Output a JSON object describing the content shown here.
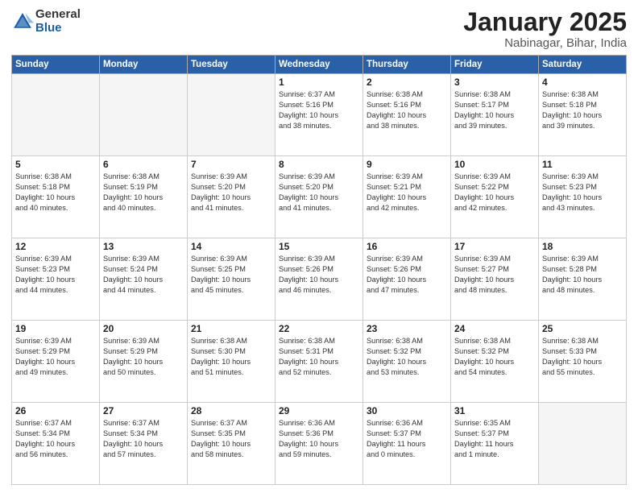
{
  "header": {
    "logo_general": "General",
    "logo_blue": "Blue",
    "title": "January 2025",
    "location": "Nabinagar, Bihar, India"
  },
  "days_of_week": [
    "Sunday",
    "Monday",
    "Tuesday",
    "Wednesday",
    "Thursday",
    "Friday",
    "Saturday"
  ],
  "weeks": [
    [
      {
        "num": "",
        "info": ""
      },
      {
        "num": "",
        "info": ""
      },
      {
        "num": "",
        "info": ""
      },
      {
        "num": "1",
        "info": "Sunrise: 6:37 AM\nSunset: 5:16 PM\nDaylight: 10 hours\nand 38 minutes."
      },
      {
        "num": "2",
        "info": "Sunrise: 6:38 AM\nSunset: 5:16 PM\nDaylight: 10 hours\nand 38 minutes."
      },
      {
        "num": "3",
        "info": "Sunrise: 6:38 AM\nSunset: 5:17 PM\nDaylight: 10 hours\nand 39 minutes."
      },
      {
        "num": "4",
        "info": "Sunrise: 6:38 AM\nSunset: 5:18 PM\nDaylight: 10 hours\nand 39 minutes."
      }
    ],
    [
      {
        "num": "5",
        "info": "Sunrise: 6:38 AM\nSunset: 5:18 PM\nDaylight: 10 hours\nand 40 minutes."
      },
      {
        "num": "6",
        "info": "Sunrise: 6:38 AM\nSunset: 5:19 PM\nDaylight: 10 hours\nand 40 minutes."
      },
      {
        "num": "7",
        "info": "Sunrise: 6:39 AM\nSunset: 5:20 PM\nDaylight: 10 hours\nand 41 minutes."
      },
      {
        "num": "8",
        "info": "Sunrise: 6:39 AM\nSunset: 5:20 PM\nDaylight: 10 hours\nand 41 minutes."
      },
      {
        "num": "9",
        "info": "Sunrise: 6:39 AM\nSunset: 5:21 PM\nDaylight: 10 hours\nand 42 minutes."
      },
      {
        "num": "10",
        "info": "Sunrise: 6:39 AM\nSunset: 5:22 PM\nDaylight: 10 hours\nand 42 minutes."
      },
      {
        "num": "11",
        "info": "Sunrise: 6:39 AM\nSunset: 5:23 PM\nDaylight: 10 hours\nand 43 minutes."
      }
    ],
    [
      {
        "num": "12",
        "info": "Sunrise: 6:39 AM\nSunset: 5:23 PM\nDaylight: 10 hours\nand 44 minutes."
      },
      {
        "num": "13",
        "info": "Sunrise: 6:39 AM\nSunset: 5:24 PM\nDaylight: 10 hours\nand 44 minutes."
      },
      {
        "num": "14",
        "info": "Sunrise: 6:39 AM\nSunset: 5:25 PM\nDaylight: 10 hours\nand 45 minutes."
      },
      {
        "num": "15",
        "info": "Sunrise: 6:39 AM\nSunset: 5:26 PM\nDaylight: 10 hours\nand 46 minutes."
      },
      {
        "num": "16",
        "info": "Sunrise: 6:39 AM\nSunset: 5:26 PM\nDaylight: 10 hours\nand 47 minutes."
      },
      {
        "num": "17",
        "info": "Sunrise: 6:39 AM\nSunset: 5:27 PM\nDaylight: 10 hours\nand 48 minutes."
      },
      {
        "num": "18",
        "info": "Sunrise: 6:39 AM\nSunset: 5:28 PM\nDaylight: 10 hours\nand 48 minutes."
      }
    ],
    [
      {
        "num": "19",
        "info": "Sunrise: 6:39 AM\nSunset: 5:29 PM\nDaylight: 10 hours\nand 49 minutes."
      },
      {
        "num": "20",
        "info": "Sunrise: 6:39 AM\nSunset: 5:29 PM\nDaylight: 10 hours\nand 50 minutes."
      },
      {
        "num": "21",
        "info": "Sunrise: 6:38 AM\nSunset: 5:30 PM\nDaylight: 10 hours\nand 51 minutes."
      },
      {
        "num": "22",
        "info": "Sunrise: 6:38 AM\nSunset: 5:31 PM\nDaylight: 10 hours\nand 52 minutes."
      },
      {
        "num": "23",
        "info": "Sunrise: 6:38 AM\nSunset: 5:32 PM\nDaylight: 10 hours\nand 53 minutes."
      },
      {
        "num": "24",
        "info": "Sunrise: 6:38 AM\nSunset: 5:32 PM\nDaylight: 10 hours\nand 54 minutes."
      },
      {
        "num": "25",
        "info": "Sunrise: 6:38 AM\nSunset: 5:33 PM\nDaylight: 10 hours\nand 55 minutes."
      }
    ],
    [
      {
        "num": "26",
        "info": "Sunrise: 6:37 AM\nSunset: 5:34 PM\nDaylight: 10 hours\nand 56 minutes."
      },
      {
        "num": "27",
        "info": "Sunrise: 6:37 AM\nSunset: 5:34 PM\nDaylight: 10 hours\nand 57 minutes."
      },
      {
        "num": "28",
        "info": "Sunrise: 6:37 AM\nSunset: 5:35 PM\nDaylight: 10 hours\nand 58 minutes."
      },
      {
        "num": "29",
        "info": "Sunrise: 6:36 AM\nSunset: 5:36 PM\nDaylight: 10 hours\nand 59 minutes."
      },
      {
        "num": "30",
        "info": "Sunrise: 6:36 AM\nSunset: 5:37 PM\nDaylight: 11 hours\nand 0 minutes."
      },
      {
        "num": "31",
        "info": "Sunrise: 6:35 AM\nSunset: 5:37 PM\nDaylight: 11 hours\nand 1 minute."
      },
      {
        "num": "",
        "info": ""
      }
    ]
  ]
}
